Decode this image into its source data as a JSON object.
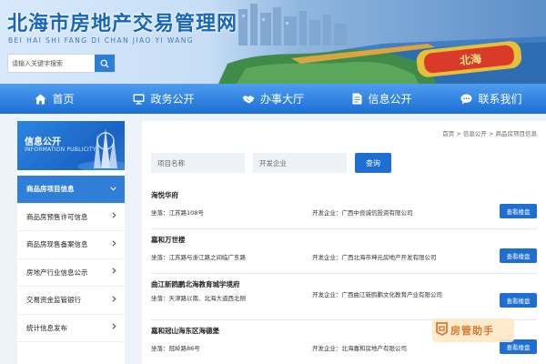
{
  "header": {
    "site_title": "北海市房地产交易管理网",
    "site_subtitle": "BEI HAI SHI FANG DI CHAN JIAO YI WANG",
    "search_placeholder": "请输入关键字搜索",
    "banner_sign_text": "北海"
  },
  "nav": {
    "items": [
      {
        "label": "首页",
        "icon": "home-icon"
      },
      {
        "label": "政务公开",
        "icon": "monitor-icon"
      },
      {
        "label": "办事大厅",
        "icon": "handshake-icon"
      },
      {
        "label": "信息公开",
        "icon": "document-icon"
      },
      {
        "label": "联系我们",
        "icon": "chat-icon"
      }
    ]
  },
  "sidebar": {
    "banner_title": "信息公开",
    "banner_subtitle": "INFORMATION PUBLICITY",
    "items": [
      {
        "label": "商品房项目信息",
        "active": true,
        "icon": "chevron-down-icon"
      },
      {
        "label": "商品房预售许可信息",
        "active": false,
        "icon": "chevron-right-icon"
      },
      {
        "label": "商品房现售备案信息",
        "active": false,
        "icon": "chevron-right-icon"
      },
      {
        "label": "房地产行业信息公示",
        "active": false,
        "icon": "chevron-right-icon"
      },
      {
        "label": "交易资金监管银行",
        "active": false,
        "icon": "chevron-right-icon"
      },
      {
        "label": "统计信息发布",
        "active": false,
        "icon": "chevron-right-icon"
      }
    ]
  },
  "breadcrumb": {
    "home": "首页",
    "sep1": ">",
    "level1": "信息公开",
    "sep2": ">",
    "current": "商品房项目信息"
  },
  "filters": {
    "project_name_placeholder": "项目名称",
    "developer_placeholder": "开发企业",
    "query_label": "查询"
  },
  "projects": [
    {
      "name": "海悦华府",
      "address": "坐落：江苏路108号",
      "developer": "开发企业：广西中良诚信投资有限公司",
      "button": "查看楼盘"
    },
    {
      "name": "嘉和万世楼",
      "address": "坐落：江苏路与浙江路之间临广东路",
      "developer": "开发企业：广西北海市坤元房地产开发有限公司",
      "button": "查看楼盘"
    },
    {
      "name": "曲江新鸥鹏北海教育城学境府",
      "address": "坐落：天津路以南、北海大道西北侧",
      "developer": "开发企业：广西曲江新鸥鹏文化教育产业有限公司",
      "button": "查看楼盘"
    },
    {
      "name": "嘉和冠山海东区海德堡",
      "address": "坐落：冠岭路86号",
      "developer": "开发企业：北海嘉和房地产有限公司",
      "button": "查看楼盘"
    }
  ],
  "watermark": {
    "text": "房管助手"
  },
  "colors": {
    "primary": "#1f6fd3",
    "nav_gradient_top": "#4f9df0",
    "nav_gradient_bottom": "#1b6fd3",
    "title_blue": "#1766b8",
    "sidebar_active": "#2f7fd8",
    "watermark_orange": "#d87a2c"
  }
}
